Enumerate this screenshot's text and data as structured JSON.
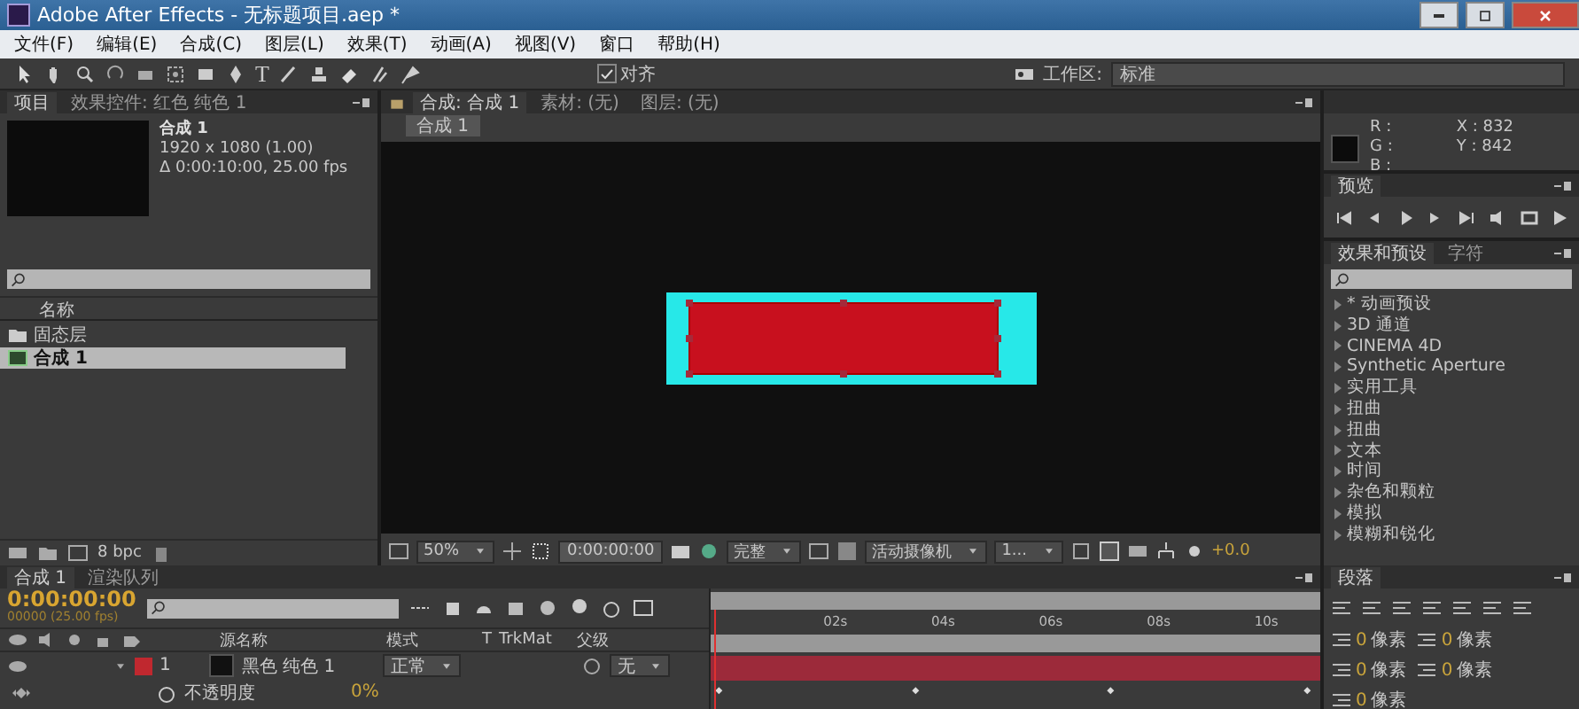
{
  "window": {
    "title": "Adobe After Effects - 无标题项目.aep *"
  },
  "menu": [
    "文件(F)",
    "编辑(E)",
    "合成(C)",
    "图层(L)",
    "效果(T)",
    "动画(A)",
    "视图(V)",
    "窗口",
    "帮助(H)"
  ],
  "toolbar": {
    "text_tool": "T",
    "snap": {
      "label": "对齐",
      "checked": true
    },
    "workspace_label": "工作区:",
    "workspace": "标准"
  },
  "project_panel": {
    "tabs": [
      {
        "label": "项目",
        "selected": true
      },
      {
        "label": "效果控件: 红色 纯色 1",
        "selected": false
      }
    ],
    "comp_name": "合成 1",
    "comp_size": "1920 x 1080 (1.00)",
    "comp_duration": "Δ 0:00:10:00, 25.00 fps",
    "column": "名称",
    "items": [
      {
        "kind": "folder",
        "name": "固态层",
        "selected": false
      },
      {
        "kind": "comp",
        "name": "合成 1",
        "selected": true
      }
    ],
    "bpc": "8 bpc"
  },
  "comp_panel": {
    "tabs": [
      {
        "label": "合成: 合成 1",
        "selected": true
      },
      {
        "label": "素材: (无)",
        "selected": false
      },
      {
        "label": "图层: (无)",
        "selected": false
      }
    ],
    "breadcrumb": "合成 1",
    "zoom": "50%",
    "timecode": "0:00:00:00",
    "resolution": "完整",
    "camera": "活动摄像机",
    "views": "1...",
    "exposure": "+0.0"
  },
  "info_panel": {
    "r": "R :",
    "g": "G :",
    "b": "B :",
    "x": "X : 832",
    "y": "Y : 842"
  },
  "preview_panel": {
    "tab": "预览"
  },
  "effects_panel": {
    "tabs": [
      {
        "label": "效果和预设",
        "selected": true
      },
      {
        "label": "字符",
        "selected": false
      }
    ],
    "items": [
      "* 动画预设",
      "3D 通道",
      "CINEMA 4D",
      "Synthetic Aperture",
      "实用工具",
      "扭曲",
      "扭曲",
      "文本",
      "时间",
      "杂色和颗粒",
      "模拟",
      "模糊和锐化"
    ]
  },
  "timeline": {
    "tabs": [
      {
        "label": "合成 1",
        "selected": true
      },
      {
        "label": "渲染队列",
        "selected": false
      }
    ],
    "timecode": "0:00:00:00",
    "frame_info": "00000 (25.00 fps)",
    "columns": [
      "源名称",
      "模式",
      "T",
      "TrkMat",
      "父级"
    ],
    "ruler": [
      "02s",
      "04s",
      "06s",
      "08s",
      "10s"
    ],
    "layers": [
      {
        "number": "1",
        "name": "黑色 纯色 1",
        "mode": "正常",
        "parent": "无",
        "color": "#c0282f"
      }
    ],
    "property": {
      "name": "不透明度",
      "value": "0%"
    }
  },
  "paragraph_panel": {
    "tab": "段落",
    "fields": [
      {
        "value": "0",
        "unit": "像素"
      },
      {
        "value": "0",
        "unit": "像素"
      },
      {
        "value": "0",
        "unit": "像素"
      },
      {
        "value": "0",
        "unit": "像素"
      },
      {
        "value": "0",
        "unit": "像素"
      }
    ]
  }
}
